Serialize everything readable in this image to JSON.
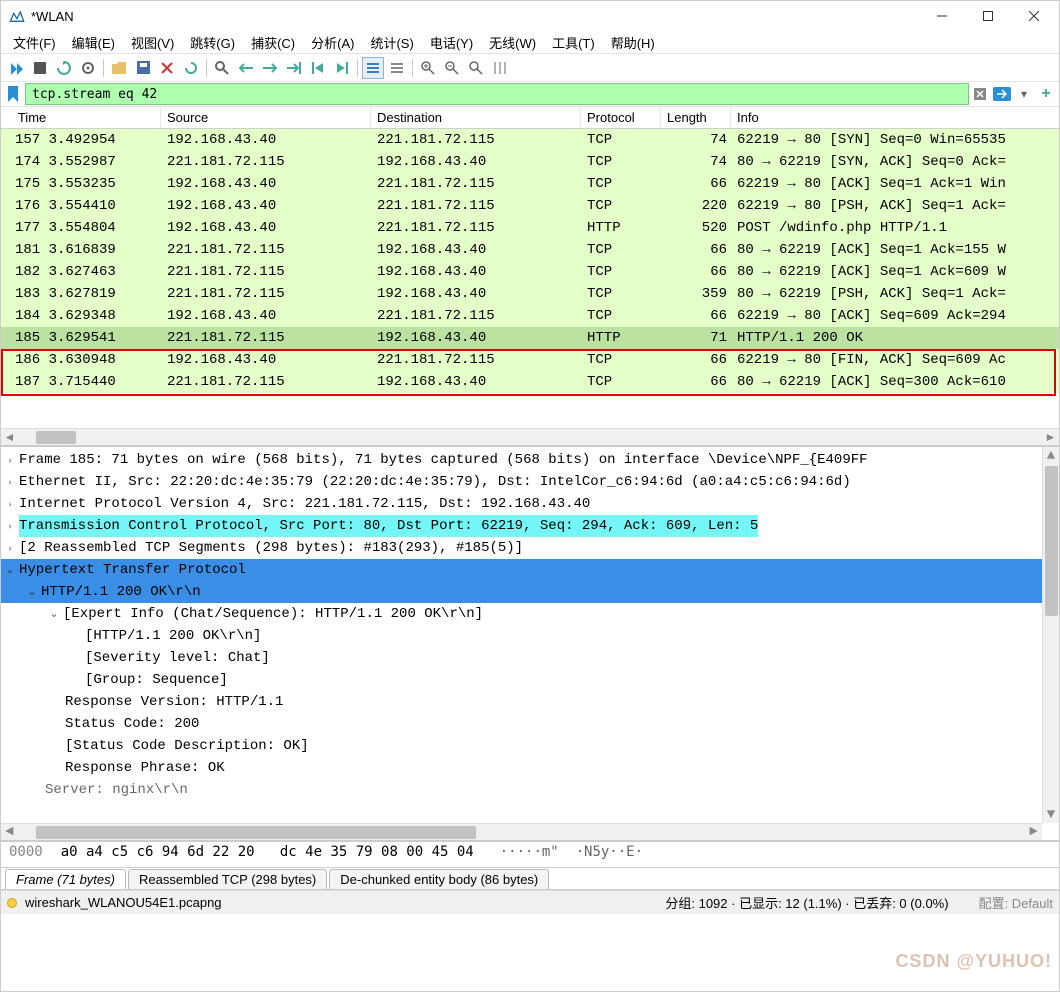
{
  "window": {
    "title": "*WLAN"
  },
  "menu": [
    "文件(F)",
    "编辑(E)",
    "视图(V)",
    "跳转(G)",
    "捕获(C)",
    "分析(A)",
    "统计(S)",
    "电话(Y)",
    "无线(W)",
    "工具(T)",
    "帮助(H)"
  ],
  "filter": {
    "value": "tcp.stream eq 42"
  },
  "columns": [
    "Time",
    "Source",
    "Destination",
    "Protocol",
    "Length",
    "Info"
  ],
  "rows": [
    {
      "no": "157",
      "time": "3.492954",
      "src": "192.168.43.40",
      "dst": "221.181.72.115",
      "proto": "TCP",
      "len": "74",
      "info": "62219 → 80 [SYN] Seq=0 Win=65535",
      "bg": "#e4ffc7"
    },
    {
      "no": "174",
      "time": "3.552987",
      "src": "221.181.72.115",
      "dst": "192.168.43.40",
      "proto": "TCP",
      "len": "74",
      "info": "80 → 62219 [SYN, ACK] Seq=0 Ack=",
      "bg": "#e4ffc7"
    },
    {
      "no": "175",
      "time": "3.553235",
      "src": "192.168.43.40",
      "dst": "221.181.72.115",
      "proto": "TCP",
      "len": "66",
      "info": "62219 → 80 [ACK] Seq=1 Ack=1 Win",
      "bg": "#e4ffc7"
    },
    {
      "no": "176",
      "time": "3.554410",
      "src": "192.168.43.40",
      "dst": "221.181.72.115",
      "proto": "TCP",
      "len": "220",
      "info": "62219 → 80 [PSH, ACK] Seq=1 Ack=",
      "bg": "#e4ffc7"
    },
    {
      "no": "177",
      "time": "3.554804",
      "src": "192.168.43.40",
      "dst": "221.181.72.115",
      "proto": "HTTP",
      "len": "520",
      "info": "POST /wdinfo.php HTTP/1.1",
      "bg": "#e4ffc7"
    },
    {
      "no": "181",
      "time": "3.616839",
      "src": "221.181.72.115",
      "dst": "192.168.43.40",
      "proto": "TCP",
      "len": "66",
      "info": "80 → 62219 [ACK] Seq=1 Ack=155 W",
      "bg": "#e4ffc7"
    },
    {
      "no": "182",
      "time": "3.627463",
      "src": "221.181.72.115",
      "dst": "192.168.43.40",
      "proto": "TCP",
      "len": "66",
      "info": "80 → 62219 [ACK] Seq=1 Ack=609 W",
      "bg": "#e4ffc7"
    },
    {
      "no": "183",
      "time": "3.627819",
      "src": "221.181.72.115",
      "dst": "192.168.43.40",
      "proto": "TCP",
      "len": "359",
      "info": "80 → 62219 [PSH, ACK] Seq=1 Ack=",
      "bg": "#e4ffc7"
    },
    {
      "no": "184",
      "time": "3.629348",
      "src": "192.168.43.40",
      "dst": "221.181.72.115",
      "proto": "TCP",
      "len": "66",
      "info": "62219 → 80 [ACK] Seq=609 Ack=294",
      "bg": "#e4ffc7"
    },
    {
      "no": "185",
      "time": "3.629541",
      "src": "221.181.72.115",
      "dst": "192.168.43.40",
      "proto": "HTTP",
      "len": "71",
      "info": "HTTP/1.1 200 OK",
      "bg": "#bce2a1"
    },
    {
      "no": "186",
      "time": "3.630948",
      "src": "192.168.43.40",
      "dst": "221.181.72.115",
      "proto": "TCP",
      "len": "66",
      "info": "62219 → 80 [FIN, ACK] Seq=609 Ac",
      "bg": "#e4ffc7"
    },
    {
      "no": "187",
      "time": "3.715440",
      "src": "221.181.72.115",
      "dst": "192.168.43.40",
      "proto": "TCP",
      "len": "66",
      "info": "80 → 62219 [ACK] Seq=300 Ack=610",
      "bg": "#e4ffc7"
    }
  ],
  "details": {
    "frame": "Frame 185: 71 bytes on wire (568 bits), 71 bytes captured (568 bits) on interface \\Device\\NPF_{E409FF",
    "eth": "Ethernet II, Src: 22:20:dc:4e:35:79 (22:20:dc:4e:35:79), Dst: IntelCor_c6:94:6d (a0:a4:c5:c6:94:6d)",
    "ip": "Internet Protocol Version 4, Src: 221.181.72.115, Dst: 192.168.43.40",
    "tcp": "Transmission Control Protocol, Src Port: 80, Dst Port: 62219, Seq: 294, Ack: 609, Len: 5",
    "reasm": "[2 Reassembled TCP Segments (298 bytes): #183(293), #185(5)]",
    "http": "Hypertext Transfer Protocol",
    "http_status": "HTTP/1.1 200 OK\\r\\n",
    "expert": "[Expert Info (Chat/Sequence): HTTP/1.1 200 OK\\r\\n]",
    "expert_sub1": "[HTTP/1.1 200 OK\\r\\n]",
    "expert_sub2": "[Severity level: Chat]",
    "expert_sub3": "[Group: Sequence]",
    "resp_ver": "Response Version: HTTP/1.1",
    "status_code": "Status Code: 200",
    "status_desc": "[Status Code Description: OK]",
    "resp_phrase": "Response Phrase: OK",
    "server": "Server: nginx\\r\\n"
  },
  "hex": {
    "offset": "0000",
    "bytes": "a0 a4 c5 c6 94 6d 22 20   dc 4e 35 79 08 00 45 04",
    "ascii": "·····m\"  ·N5y··E·"
  },
  "tabs": [
    {
      "label": "Frame (71 bytes)",
      "active": true
    },
    {
      "label": "Reassembled TCP (298 bytes)",
      "active": false
    },
    {
      "label": "De-chunked entity body (86 bytes)",
      "active": false
    }
  ],
  "status": {
    "file": "wireshark_WLANOU54E1.pcapng",
    "center": "分组: 1092 · 已显示: 12 (1.1%) · 已丢弃: 0 (0.0%)",
    "profile": "配置: Default"
  },
  "watermark": "CSDN @YUHUO!"
}
